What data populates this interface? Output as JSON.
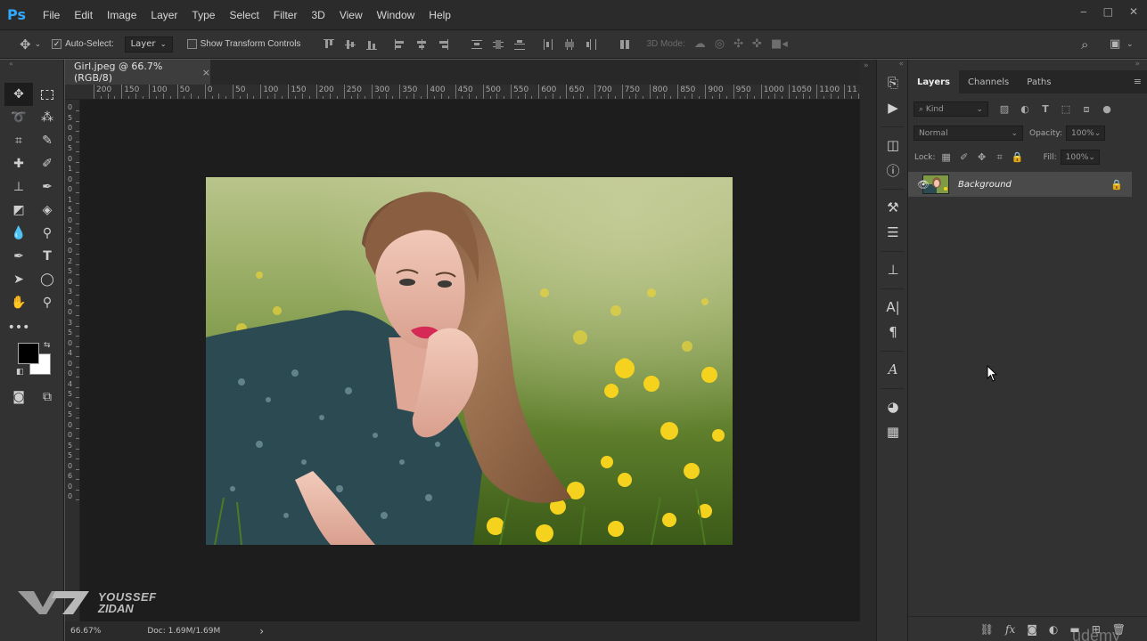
{
  "app": {
    "logo": "Ps"
  },
  "menu": [
    "File",
    "Edit",
    "Image",
    "Layer",
    "Type",
    "Select",
    "Filter",
    "3D",
    "View",
    "Window",
    "Help"
  ],
  "window_controls": {
    "minimize": "‒",
    "maximize": "□",
    "close": "✕"
  },
  "options": {
    "auto_select_label": "Auto-Select:",
    "auto_select_checked": true,
    "auto_select_target": "Layer",
    "show_transform_label": "Show Transform Controls",
    "show_transform_checked": false,
    "mode_3d_label": "3D Mode:"
  },
  "document": {
    "tab_title": "Girl.jpeg @ 66.7% (RGB/8)",
    "tab_close": "×",
    "ruler_top_labels": [
      "200",
      "150",
      "100",
      "50",
      "0",
      "50",
      "100",
      "150",
      "200",
      "250",
      "300",
      "350",
      "400",
      "450",
      "500",
      "550",
      "600",
      "650",
      "700",
      "750",
      "800",
      "850",
      "900",
      "950",
      "1000",
      "1050",
      "1100",
      "11"
    ],
    "ruler_left_labels": [
      "0",
      "5",
      "0",
      "0",
      "5",
      "0",
      "1",
      "0",
      "0",
      "1",
      "5",
      "0",
      "2",
      "0",
      "0",
      "2",
      "5",
      "0",
      "3",
      "0",
      "0",
      "3",
      "5",
      "0",
      "4",
      "0",
      "0",
      "4",
      "5",
      "0",
      "5",
      "0",
      "0",
      "5",
      "5",
      "0",
      "6",
      "0",
      "0"
    ],
    "zoom": "66.67%",
    "doc_info": "Doc: 1.69M/1.69M",
    "status_arrow": "›"
  },
  "watermark": {
    "line1": "YOUSSEF",
    "line2": "ZIDAN"
  },
  "layers_panel": {
    "tabs": [
      "Layers",
      "Channels",
      "Paths"
    ],
    "active_tab": "Layers",
    "filter_kind": "Kind",
    "blend_mode": "Normal",
    "opacity_label": "Opacity:",
    "opacity_value": "100%",
    "lock_label": "Lock:",
    "fill_label": "Fill:",
    "fill_value": "100%",
    "layers": [
      {
        "name": "Background",
        "visible": true,
        "locked": true
      }
    ]
  },
  "corner_text": "udemy",
  "colors": {
    "ps_blue": "#31a8ff",
    "panel_bg": "#323232",
    "canvas_bg": "#1d1d1d"
  }
}
